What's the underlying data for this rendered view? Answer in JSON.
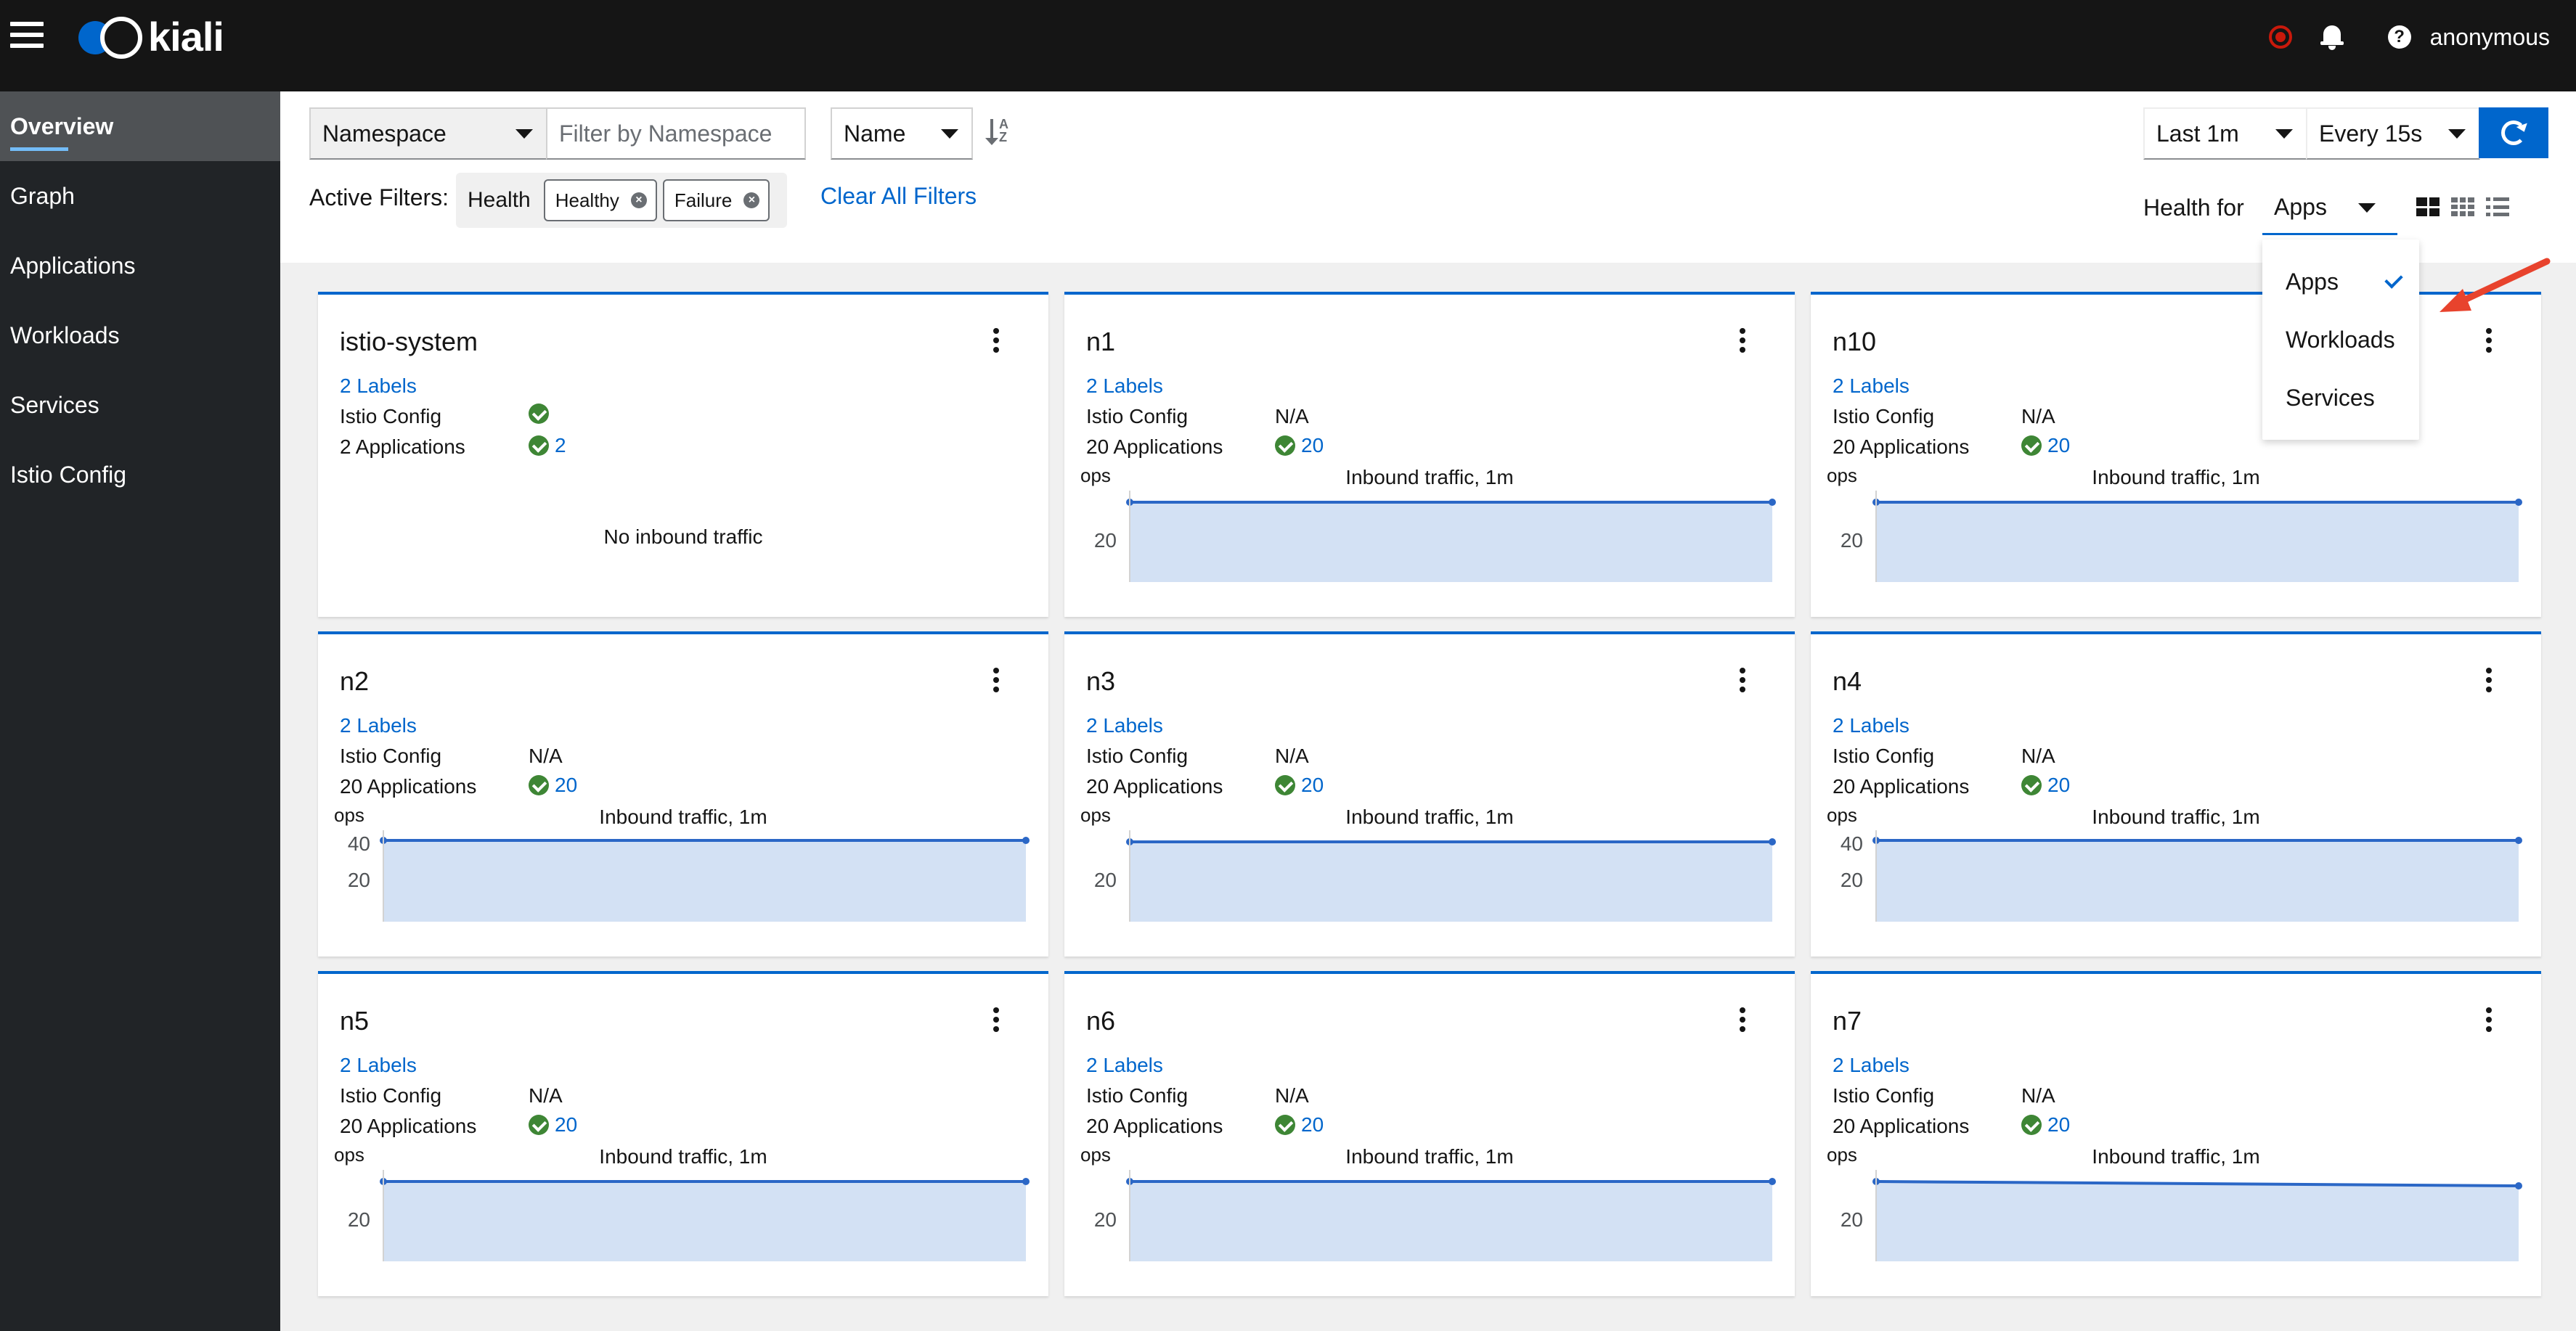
{
  "masthead": {
    "logo_text": "kiali",
    "user": "anonymous",
    "icons": [
      "menu-icon",
      "kiali-logo-icon",
      "record-icon",
      "bell-icon",
      "help-icon"
    ]
  },
  "sidebar": {
    "items": [
      {
        "label": "Overview",
        "active": true
      },
      {
        "label": "Graph"
      },
      {
        "label": "Applications"
      },
      {
        "label": "Workloads"
      },
      {
        "label": "Services"
      },
      {
        "label": "Istio Config"
      }
    ]
  },
  "toolbar": {
    "filter_type": "Namespace",
    "filter_placeholder": "Filter by Namespace",
    "sort_field": "Name",
    "time_range": "Last 1m",
    "refresh_interval": "Every 15s",
    "active_filters_label": "Active Filters:",
    "filter_group_label": "Health",
    "chips": [
      "Healthy",
      "Failure"
    ],
    "clear_all": "Clear All Filters",
    "health_for_label": "Health for",
    "health_for_value": "Apps"
  },
  "health_menu": {
    "items": [
      "Apps",
      "Workloads",
      "Services"
    ],
    "selected": "Apps"
  },
  "colors": {
    "accent": "#0066cc",
    "success": "#3e8635",
    "chart_fill": "#d3e1f4",
    "chart_line": "#2b67c6",
    "arrow": "#e8432d"
  },
  "cards": [
    {
      "name": "istio-system",
      "labels": "2 Labels",
      "istio_config_label": "Istio Config",
      "istio_config": "",
      "apps_label": "2 Applications",
      "apps_count": "2",
      "no_traffic": "No inbound traffic"
    },
    {
      "name": "n1",
      "labels": "2 Labels",
      "istio_config_label": "Istio Config",
      "istio_config": "N/A",
      "apps_label": "20 Applications",
      "apps_count": "20",
      "chart_title": "Inbound traffic, 1m",
      "chart_unit": "ops",
      "ticks": [
        "20"
      ]
    },
    {
      "name": "n10",
      "labels": "2 Labels",
      "istio_config_label": "Istio Config",
      "istio_config": "N/A",
      "apps_label": "20 Applications",
      "apps_count": "20",
      "chart_title": "Inbound traffic, 1m",
      "chart_unit": "ops",
      "ticks": [
        "20"
      ]
    },
    {
      "name": "n2",
      "labels": "2 Labels",
      "istio_config_label": "Istio Config",
      "istio_config": "N/A",
      "apps_label": "20 Applications",
      "apps_count": "20",
      "chart_title": "Inbound traffic, 1m",
      "chart_unit": "ops",
      "ticks": [
        "40",
        "20"
      ]
    },
    {
      "name": "n3",
      "labels": "2 Labels",
      "istio_config_label": "Istio Config",
      "istio_config": "N/A",
      "apps_label": "20 Applications",
      "apps_count": "20",
      "chart_title": "Inbound traffic, 1m",
      "chart_unit": "ops",
      "ticks": [
        "20"
      ]
    },
    {
      "name": "n4",
      "labels": "2 Labels",
      "istio_config_label": "Istio Config",
      "istio_config": "N/A",
      "apps_label": "20 Applications",
      "apps_count": "20",
      "chart_title": "Inbound traffic, 1m",
      "chart_unit": "ops",
      "ticks": [
        "40",
        "20"
      ]
    },
    {
      "name": "n5",
      "labels": "2 Labels",
      "istio_config_label": "Istio Config",
      "istio_config": "N/A",
      "apps_label": "20 Applications",
      "apps_count": "20",
      "chart_title": "Inbound traffic, 1m",
      "chart_unit": "ops",
      "ticks": [
        "20"
      ]
    },
    {
      "name": "n6",
      "labels": "2 Labels",
      "istio_config_label": "Istio Config",
      "istio_config": "N/A",
      "apps_label": "20 Applications",
      "apps_count": "20",
      "chart_title": "Inbound traffic, 1m",
      "chart_unit": "ops",
      "ticks": [
        "20"
      ]
    },
    {
      "name": "n7",
      "labels": "2 Labels",
      "istio_config_label": "Istio Config",
      "istio_config": "N/A",
      "apps_label": "20 Applications",
      "apps_count": "20",
      "chart_title": "Inbound traffic, 1m",
      "chart_unit": "ops",
      "ticks": [
        "20"
      ]
    }
  ]
}
